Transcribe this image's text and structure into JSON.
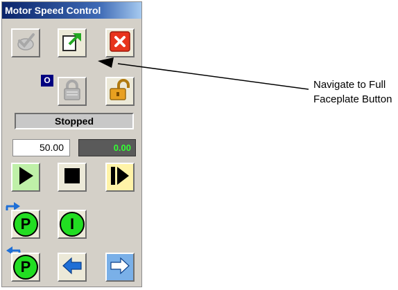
{
  "window": {
    "title": "Motor Speed Control"
  },
  "mode": {
    "indicator": "O"
  },
  "status": {
    "text": "Stopped"
  },
  "speed": {
    "setpoint": "50.00",
    "actual": "0.00"
  },
  "icons": {
    "acknowledge": "check-disabled-icon",
    "navigate": "navigate-arrow-icon",
    "close": "close-x-icon",
    "lock": "padlock-locked-icon",
    "unlock": "padlock-unlocked-icon",
    "start": "play-icon",
    "stop": "stop-icon",
    "jog": "step-forward-icon",
    "program": "p-circle-icon",
    "interlock": "i-circle-icon",
    "prev": "arrow-left-icon",
    "next": "arrow-right-icon"
  },
  "buttons": {
    "program_top_letter": "P",
    "interlock_letter": "I",
    "program_bottom_letter": "P"
  },
  "colors": {
    "title_bar": "#0a246a",
    "status_bg": "#c8c8c8",
    "pv_text": "#33ff33",
    "indicator_green": "#22dd22",
    "close_red": "#e8341c",
    "lock_gold": "#e8a020",
    "arrow_blue": "#1f6fd6"
  },
  "annotation": {
    "line1": "Navigate to Full",
    "line2": "Faceplate Button"
  }
}
